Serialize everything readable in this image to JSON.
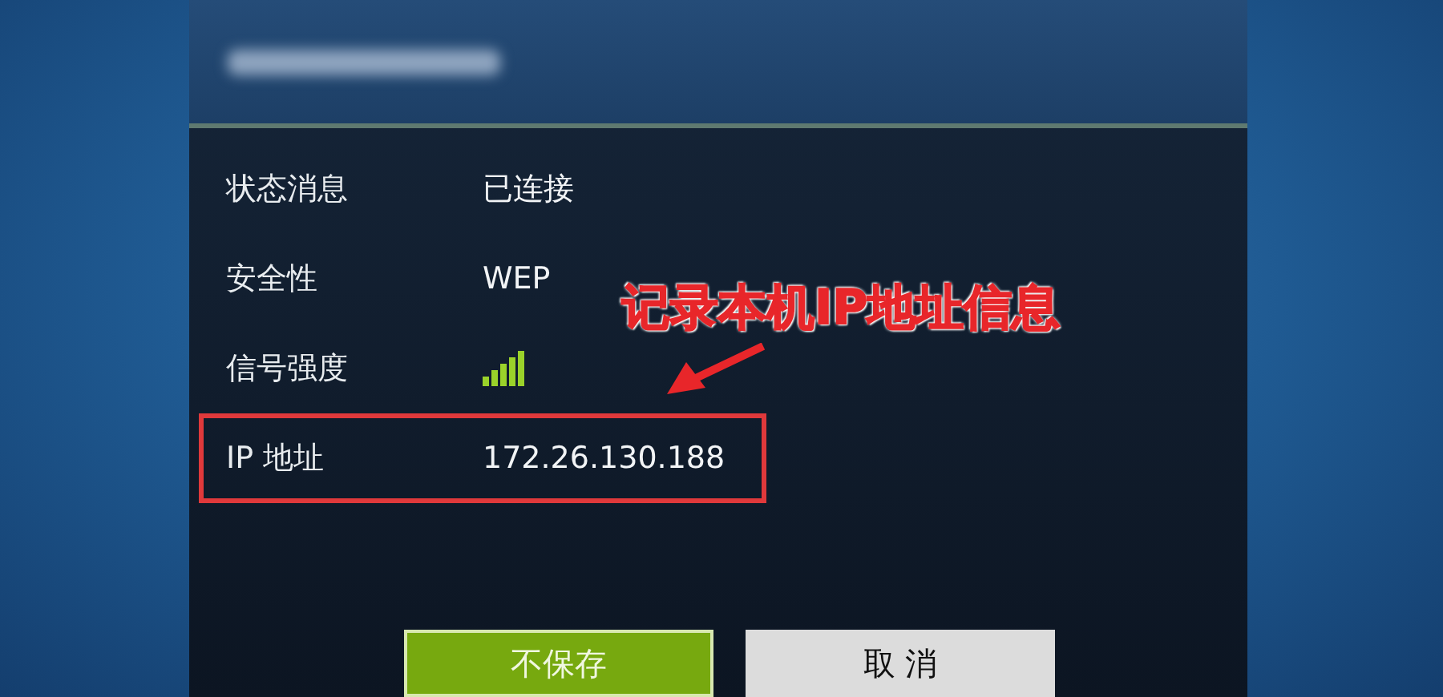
{
  "dialog": {
    "rows": [
      {
        "label": "状态消息",
        "value": "已连接",
        "kind": "text",
        "highlighted": false
      },
      {
        "label": "安全性",
        "value": "WEP",
        "kind": "text",
        "highlighted": false
      },
      {
        "label": "信号强度",
        "kind": "signal",
        "highlighted": false
      },
      {
        "label": "IP 地址",
        "value": "172.26.130.188",
        "kind": "text",
        "highlighted": true
      }
    ],
    "buttons": [
      {
        "label": "不保存",
        "kind": "primary"
      },
      {
        "label": "取 消",
        "kind": "secondary"
      }
    ]
  },
  "annotation": {
    "text": "记录本机IP地址信息"
  }
}
